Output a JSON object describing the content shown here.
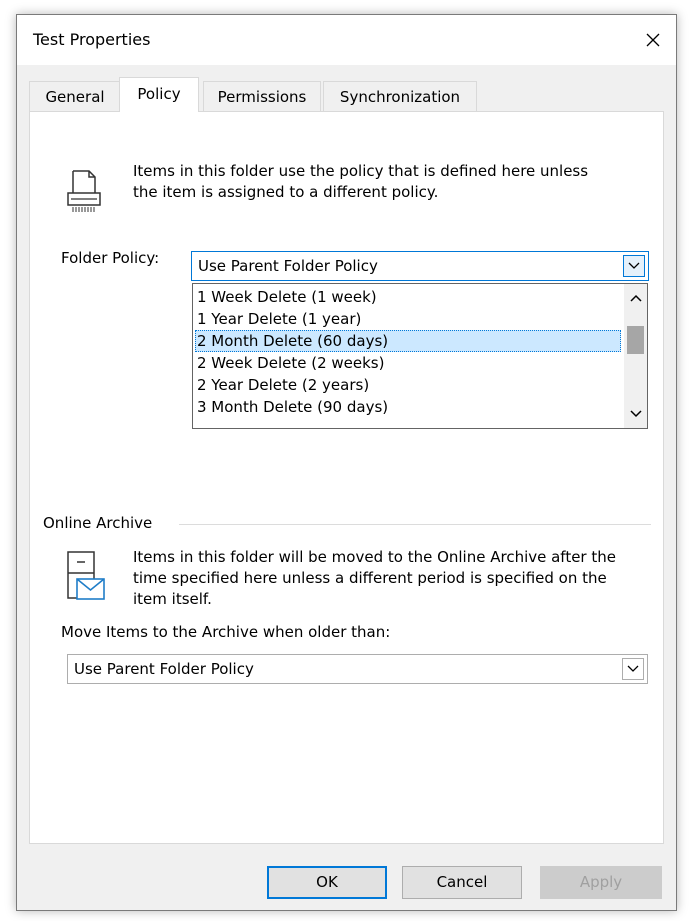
{
  "window": {
    "title": "Test Properties"
  },
  "tabs": [
    {
      "label": "General"
    },
    {
      "label": "Policy"
    },
    {
      "label": "Permissions"
    },
    {
      "label": "Synchronization"
    }
  ],
  "policy": {
    "description": "Items in this folder use the policy that is defined here unless the item is assigned to a different policy.",
    "folder_policy_label": "Folder Policy:",
    "folder_policy_value": "Use Parent Folder Policy",
    "options": [
      "1 Week Delete (1 week)",
      "1 Year Delete (1 year)",
      "2 Month Delete (60 days)",
      "2 Week Delete (2 weeks)",
      "2 Year Delete (2 years)",
      "3 Month Delete (90 days)"
    ],
    "selected_option": "2 Month Delete (60 days)"
  },
  "archive": {
    "group_label": "Online Archive",
    "description": "Items in this folder will be moved to the Online Archive after the time specified here unless a different period is specified on the item itself.",
    "move_label": "Move Items to the Archive when older than:",
    "move_value": "Use Parent Folder Policy"
  },
  "buttons": {
    "ok": "OK",
    "cancel": "Cancel",
    "apply": "Apply"
  },
  "icons": {
    "close": "close-icon",
    "policy": "shredder-icon",
    "archive": "archive-cabinet-icon"
  },
  "colors": {
    "accent": "#0078d7",
    "selection": "#cce8ff"
  }
}
